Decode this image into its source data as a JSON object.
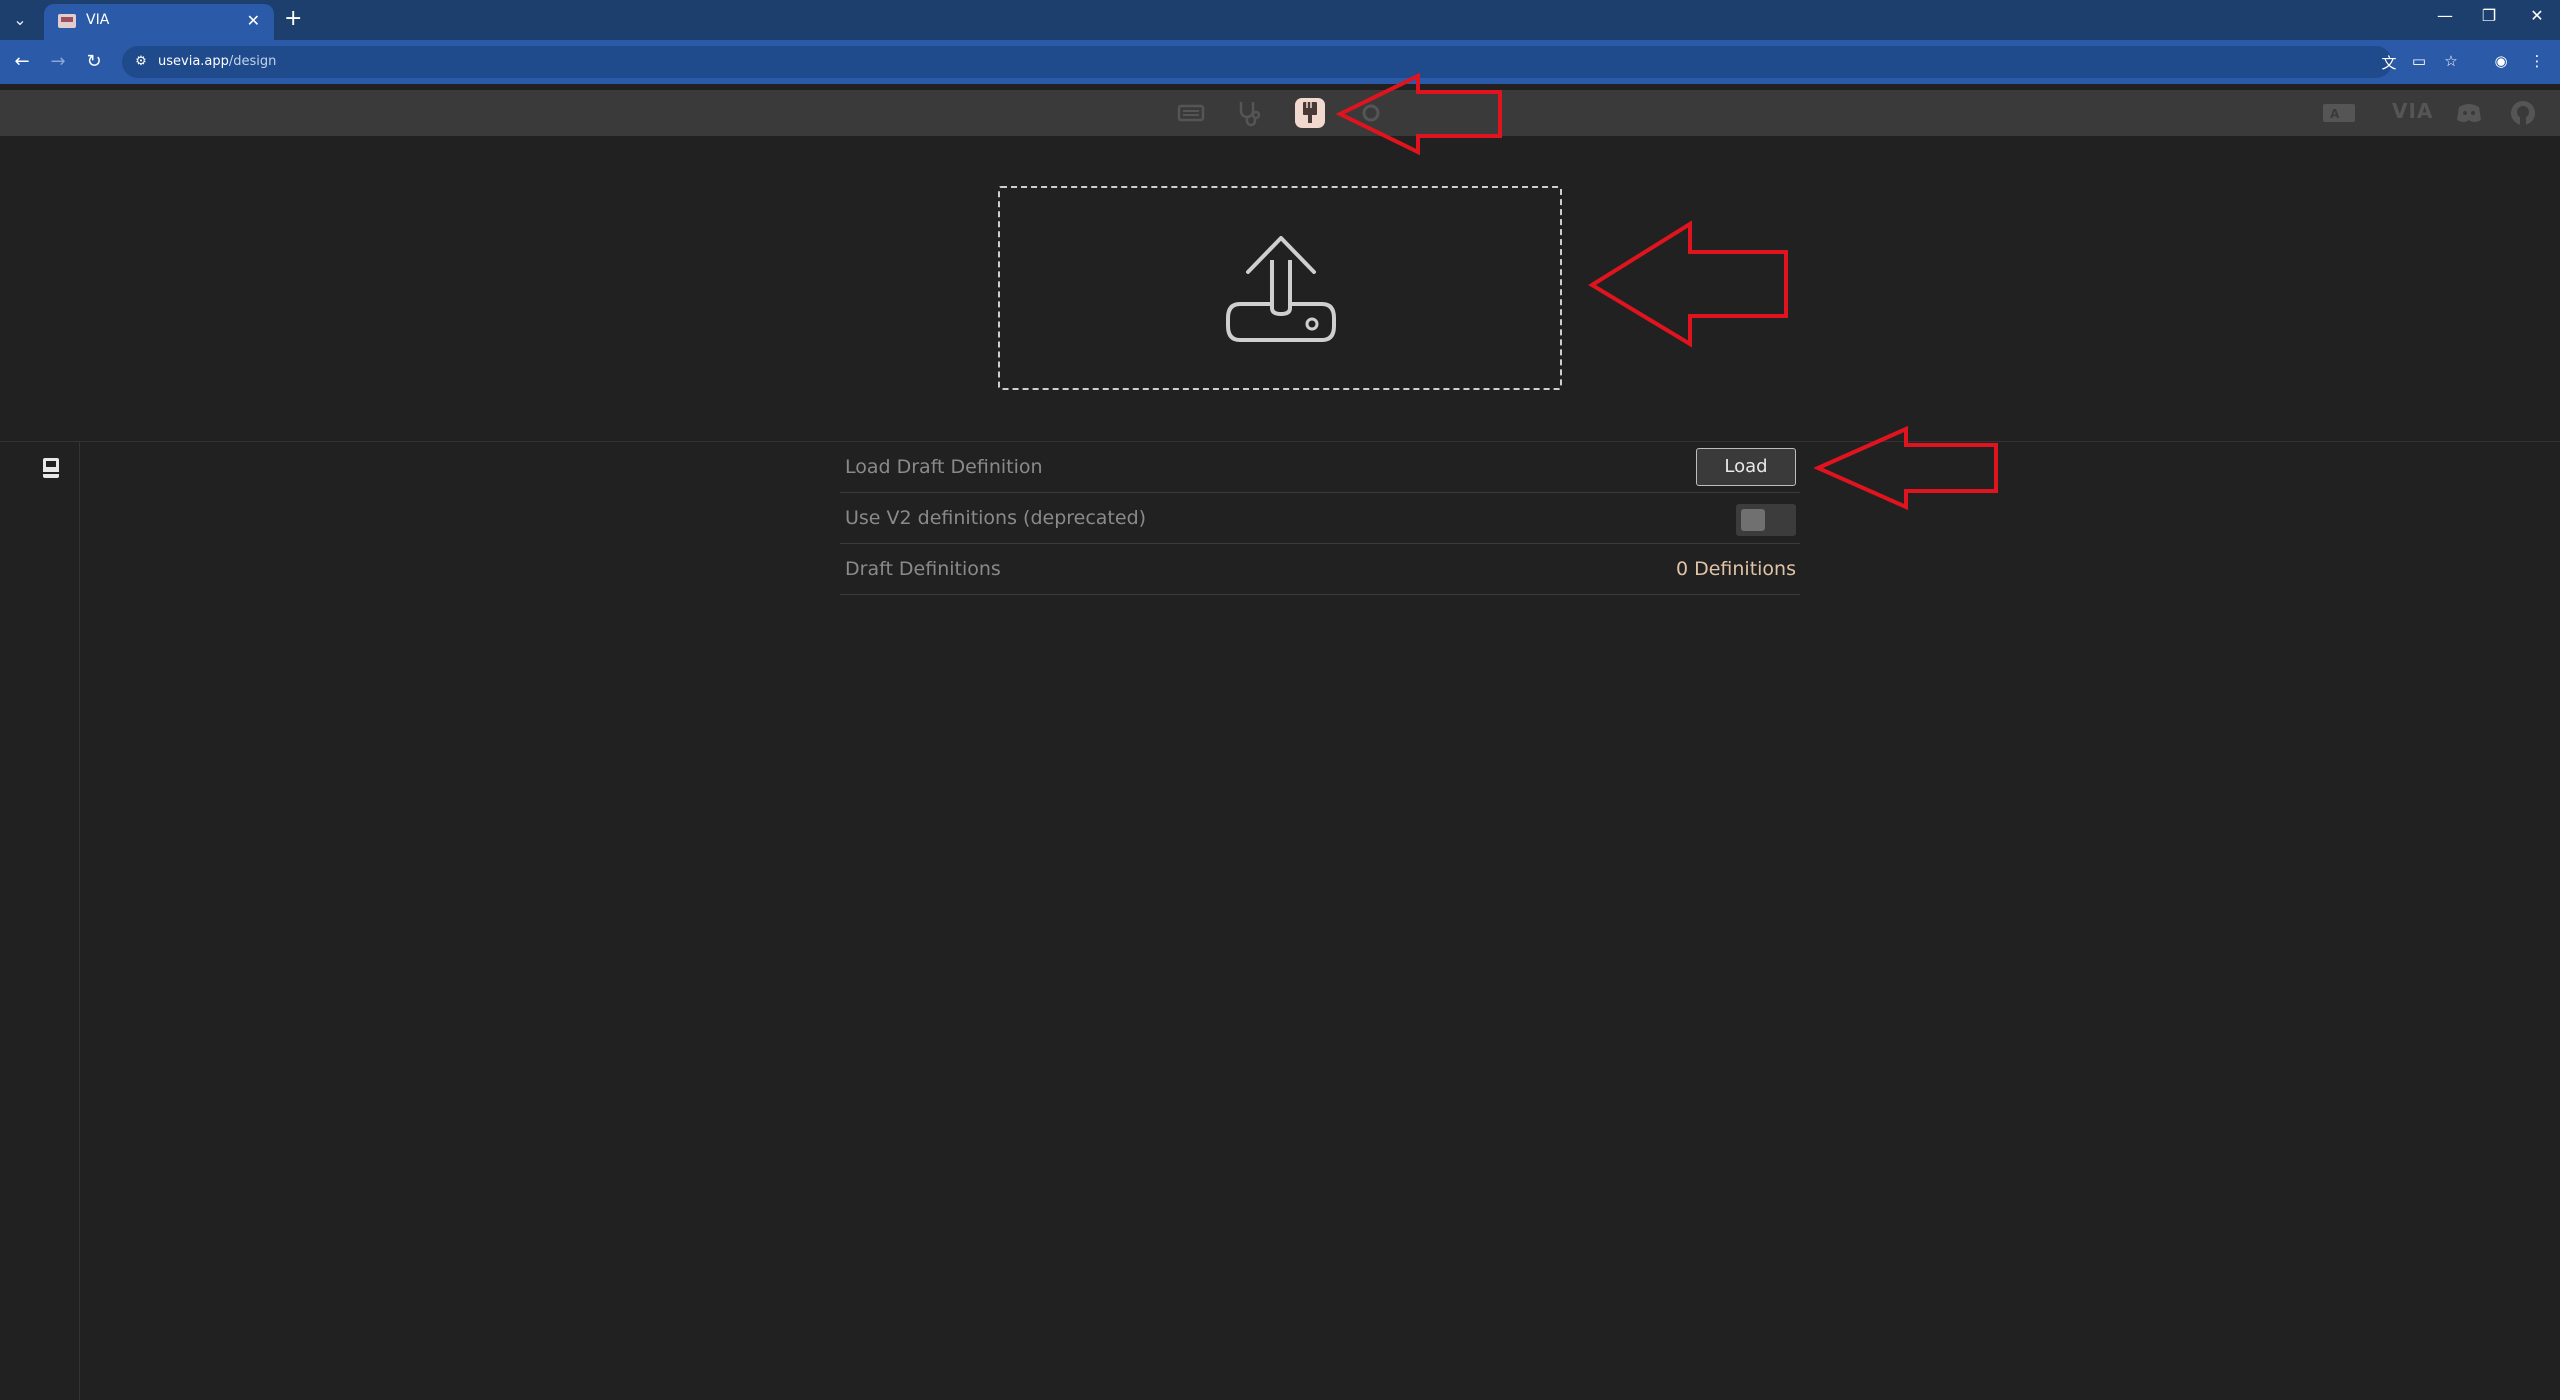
{
  "browser": {
    "tab_title": "VIA",
    "url_host": "usevia.app",
    "url_path": "/design"
  },
  "app": {
    "menu_icons": [
      "keyboard-icon",
      "stethoscope-icon",
      "paintbrush-icon"
    ],
    "right_icons": [
      "translate-icon",
      "via-logo",
      "discord-icon",
      "github-icon"
    ],
    "right_logo_text": "VIA"
  },
  "settings": {
    "load_draft_label": "Load Draft Definition",
    "load_button_label": "Load",
    "use_v2_label": "Use V2 definitions (deprecated)",
    "use_v2_enabled": false,
    "draft_definitions_label": "Draft Definitions",
    "draft_definitions_value": "0 Definitions"
  },
  "colors": {
    "annotation_arrow": "#e0141e",
    "active_menu_bg": "#f1d9cf",
    "accent_value": "#e0c4a8"
  }
}
